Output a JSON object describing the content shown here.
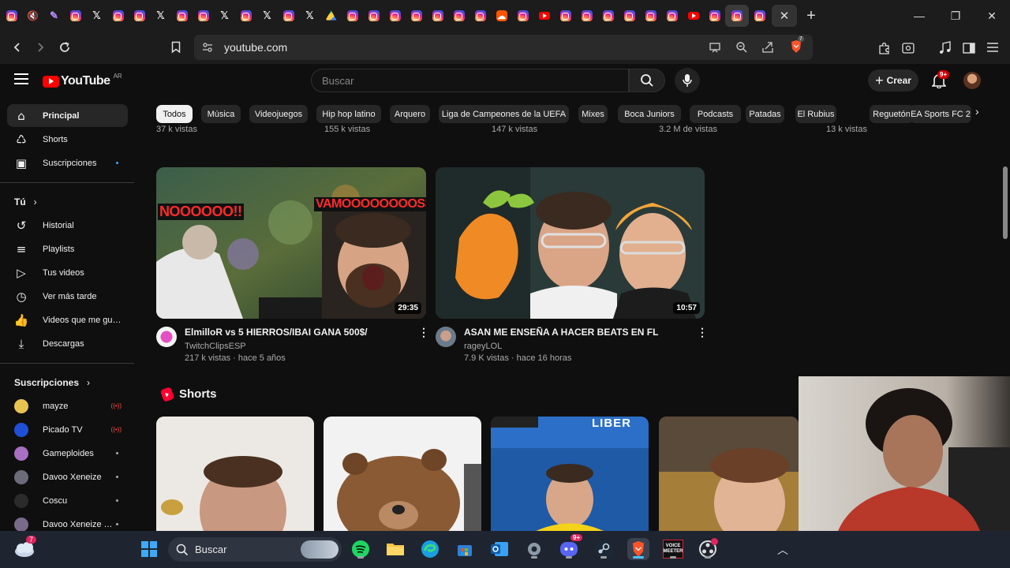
{
  "browser": {
    "tabs": [
      "instagram",
      "mute",
      "feather",
      "instagram",
      "x",
      "instagram",
      "instagram",
      "x",
      "instagram",
      "instagram",
      "x",
      "instagram",
      "x",
      "instagram",
      "x",
      "drive",
      "instagram",
      "instagram",
      "instagram",
      "instagram",
      "instagram",
      "instagram",
      "instagram",
      "soundcloud",
      "instagram",
      "youtube",
      "instagram",
      "instagram",
      "instagram",
      "instagram",
      "instagram",
      "instagram",
      "youtube",
      "instagram",
      "instagram",
      "instagram"
    ],
    "active_tab_close": "✕",
    "new_tab": "+",
    "window_controls": [
      "—",
      "❐",
      "✕"
    ],
    "url": "youtube.com",
    "brave_badge": "7"
  },
  "yt_header": {
    "logo_text": "YouTube",
    "country_code": "AR",
    "search_placeholder": "Buscar",
    "create_label": "Crear",
    "notif_badge": "9+"
  },
  "sidebar": {
    "main": [
      {
        "icon": "home-icon",
        "glyph": "⌂",
        "label": "Principal"
      },
      {
        "icon": "shorts-icon",
        "glyph": "♺",
        "label": "Shorts"
      },
      {
        "icon": "subscriptions-icon",
        "glyph": "▣",
        "label": "Suscripciones"
      }
    ],
    "you_heading": "Tú",
    "you": [
      {
        "icon": "history-icon",
        "glyph": "↺",
        "label": "Historial"
      },
      {
        "icon": "playlists-icon",
        "glyph": "≡",
        "label": "Playlists"
      },
      {
        "icon": "your-videos-icon",
        "glyph": "▷",
        "label": "Tus videos"
      },
      {
        "icon": "watch-later-icon",
        "glyph": "◷",
        "label": "Ver más tarde"
      },
      {
        "icon": "liked-videos-icon",
        "glyph": "👍",
        "label": "Videos que me gus..."
      },
      {
        "icon": "downloads-icon",
        "glyph": "⤓",
        "label": "Descargas"
      }
    ],
    "subs_heading": "Suscripciones",
    "subs": [
      {
        "name": "mayze",
        "status": "live",
        "color": "#e8c350"
      },
      {
        "name": "Picado TV",
        "status": "live",
        "color": "#1f4fd6"
      },
      {
        "name": "Gameploides",
        "status": "new",
        "color": "#a86fc2"
      },
      {
        "name": "Davoo Xeneize",
        "status": "new",
        "color": "#6b6b7a"
      },
      {
        "name": "Coscu",
        "status": "new",
        "color": "#2b2b2b"
      },
      {
        "name": "Davoo Xeneize T...",
        "status": "new",
        "color": "#7a6a8a"
      }
    ]
  },
  "chips": [
    "Todos",
    "Música",
    "Videojuegos",
    "Hip hop latino",
    "Arquero",
    "Liga de Campeones de la UEFA",
    "Mixes",
    "Boca Juniors",
    "Podcasts",
    "Patadas",
    "El Rubius",
    "Reguetón",
    "EA Sports FC 2"
  ],
  "cut_row_meta": [
    "37 k vistas",
    "155 k vistas",
    "147 k vistas",
    "3.2 M de vistas",
    "13 k vistas"
  ],
  "videos": [
    {
      "title": "ElmilloR vs 5 HIERROS/IBAI GANA 500$/",
      "channel": "TwitchClipsESP",
      "meta": "217 k vistas · hace 5 años",
      "duration": "29:35",
      "overlay_left": "NOOOOOO!!",
      "overlay_right": "VAMOOOOOOOOSS!!!"
    },
    {
      "title": "ASAN ME ENSEÑA A HACER BEATS EN FL",
      "channel": "rageyLOL",
      "meta": "7.9 K vistas · hace 16 horas",
      "duration": "10:57"
    }
  ],
  "shorts_heading": "Shorts",
  "shorts_overlay": "LIBER",
  "taskbar": {
    "weather_badge": "7",
    "search_label": "Buscar",
    "discord_badge": "9+",
    "voicemeeter_label": "VOICE MEETER"
  }
}
